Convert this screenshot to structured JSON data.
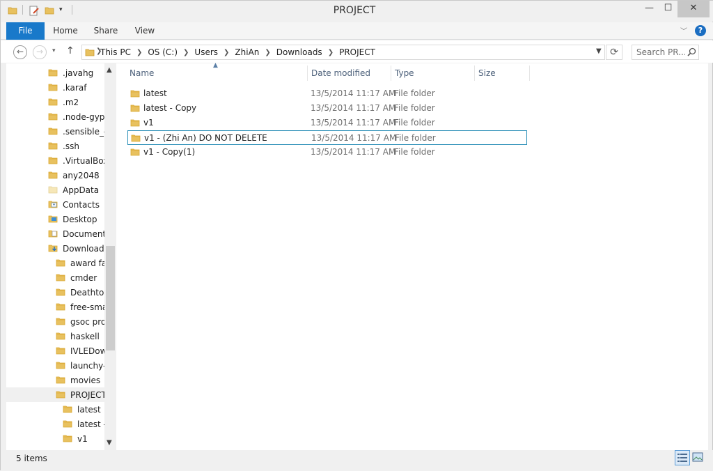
{
  "window": {
    "title": "PROJECT",
    "min_glyph": "—",
    "max_glyph": "☐",
    "close_glyph": "✕"
  },
  "ribbon": {
    "tabs": [
      "File",
      "Home",
      "Share",
      "View"
    ],
    "help_glyph": "?"
  },
  "address": {
    "crumbs": [
      "This PC",
      "OS (C:)",
      "Users",
      "ZhiAn",
      "Downloads",
      "PROJECT"
    ],
    "separator": "❯"
  },
  "search": {
    "placeholder": "Search PR..."
  },
  "nav_tree": [
    {
      "label": ".javahg",
      "icon": "folder-icon",
      "level": 1
    },
    {
      "label": ".karaf",
      "icon": "folder-icon",
      "level": 1
    },
    {
      "label": ".m2",
      "icon": "folder-icon",
      "level": 1
    },
    {
      "label": ".node-gyp",
      "icon": "folder-icon",
      "level": 1
    },
    {
      "label": ".sensible_ci",
      "icon": "folder-icon",
      "level": 1
    },
    {
      "label": ".ssh",
      "icon": "folder-icon",
      "level": 1
    },
    {
      "label": ".VirtualBox",
      "icon": "folder-icon",
      "level": 1
    },
    {
      "label": "any2048",
      "icon": "folder-icon",
      "level": 1
    },
    {
      "label": "AppData",
      "icon": "hidden-folder-icon",
      "level": 1
    },
    {
      "label": "Contacts",
      "icon": "contacts-folder-icon",
      "level": 1
    },
    {
      "label": "Desktop",
      "icon": "desktop-folder-icon",
      "level": 1
    },
    {
      "label": "Documents",
      "icon": "documents-folder-icon",
      "level": 1
    },
    {
      "label": "Downloads",
      "icon": "downloads-folder-icon",
      "level": 1
    },
    {
      "label": "award fac",
      "icon": "folder-icon",
      "level": 2
    },
    {
      "label": "cmder",
      "icon": "folder-icon",
      "level": 2
    },
    {
      "label": "DeathtoS",
      "icon": "folder-icon",
      "level": 2
    },
    {
      "label": "free-smas",
      "icon": "folder-icon",
      "level": 2
    },
    {
      "label": "gsoc prog",
      "icon": "folder-icon",
      "level": 2
    },
    {
      "label": "haskell",
      "icon": "folder-icon",
      "level": 2
    },
    {
      "label": "IVLEDown",
      "icon": "folder-icon",
      "level": 2
    },
    {
      "label": "launchy-",
      "icon": "folder-icon",
      "level": 2
    },
    {
      "label": "movies",
      "icon": "folder-icon",
      "level": 2
    },
    {
      "label": "PROJECT",
      "icon": "folder-icon",
      "level": 2,
      "selected": true
    },
    {
      "label": "latest",
      "icon": "folder-icon",
      "level": 3
    },
    {
      "label": "latest -",
      "icon": "folder-icon",
      "level": 3
    },
    {
      "label": "v1",
      "icon": "folder-icon",
      "level": 3
    }
  ],
  "columns": {
    "name": "Name",
    "date": "Date modified",
    "type": "Type",
    "size": "Size",
    "sort_glyph": "▲"
  },
  "files": [
    {
      "name": "latest",
      "date": "13/5/2014 11:17 AM",
      "type": "File folder"
    },
    {
      "name": "latest - Copy",
      "date": "13/5/2014 11:17 AM",
      "type": "File folder"
    },
    {
      "name": "v1",
      "date": "13/5/2014 11:17 AM",
      "type": "File folder"
    },
    {
      "name": "v1 - (Zhi An) DO NOT DELETE",
      "date": "13/5/2014 11:17 AM",
      "type": "File folder",
      "focused": true
    },
    {
      "name": "v1 - Copy(1)",
      "date": "13/5/2014 11:17 AM",
      "type": "File folder"
    }
  ],
  "status": {
    "item_count": "5 items"
  },
  "colors": {
    "accent": "#1979ca",
    "folder": "#e8c15f",
    "folder_dark": "#d9a62e",
    "focus_border": "#2d90b8"
  }
}
